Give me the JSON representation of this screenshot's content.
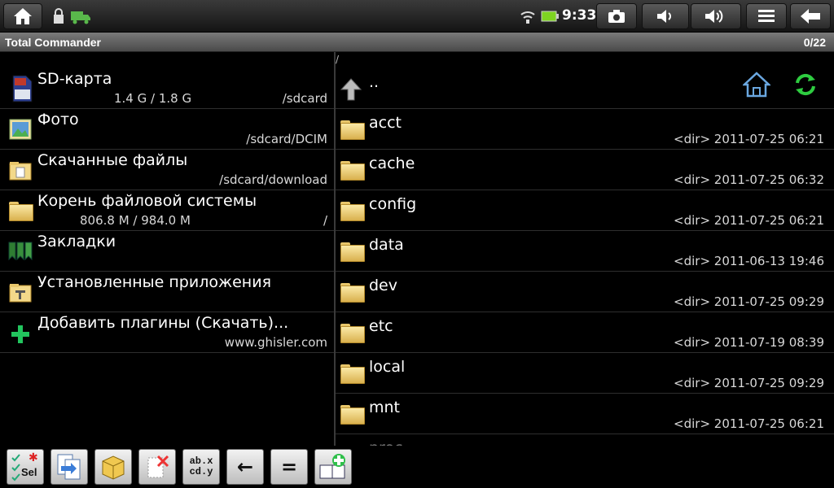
{
  "statusbar": {
    "time": "9:33",
    "icons": [
      "home-icon",
      "lock-icon",
      "truck-icon",
      "wifi-icon",
      "battery-icon",
      "camera-icon",
      "volume-down-icon",
      "volume-up-icon",
      "menu-icon",
      "back-arrow-icon"
    ]
  },
  "titlebar": {
    "title": "Total Commander",
    "count": "0/22"
  },
  "left_panel": {
    "items": [
      {
        "name": "SD-карта",
        "sub": "1.4 G / 1.8 G",
        "sub_right": "/sdcard",
        "icon": "sd-card-icon"
      },
      {
        "name": "Фото",
        "sub": "",
        "sub_right": "/sdcard/DCIM",
        "icon": "photo-icon"
      },
      {
        "name": "Скачанные файлы",
        "sub": "",
        "sub_right": "/sdcard/download",
        "icon": "download-folder-icon"
      },
      {
        "name": "Корень файловой системы",
        "sub": "806.8 M / 984.0 M",
        "sub_right": "/",
        "icon": "folder-icon"
      },
      {
        "name": "Закладки",
        "sub": "",
        "sub_right": "",
        "icon": "bookmarks-icon"
      },
      {
        "name": "Установленные приложения",
        "sub": "",
        "sub_right": "",
        "icon": "apps-folder-icon"
      },
      {
        "name": "Добавить плагины (Скачать)...",
        "sub": "",
        "sub_right": "www.ghisler.com",
        "icon": "plus-icon"
      }
    ]
  },
  "right_panel": {
    "path": "/",
    "parent": "..",
    "items": [
      {
        "name": "acct",
        "type": "<dir>",
        "date": "2011-07-25",
        "time": "06:21"
      },
      {
        "name": "cache",
        "type": "<dir>",
        "date": "2011-07-25",
        "time": "06:32"
      },
      {
        "name": "config",
        "type": "<dir>",
        "date": "2011-07-25",
        "time": "06:21"
      },
      {
        "name": "data",
        "type": "<dir>",
        "date": "2011-06-13",
        "time": "19:46"
      },
      {
        "name": "dev",
        "type": "<dir>",
        "date": "2011-07-25",
        "time": "09:29"
      },
      {
        "name": "etc",
        "type": "<dir>",
        "date": "2011-07-19",
        "time": "08:39"
      },
      {
        "name": "local",
        "type": "<dir>",
        "date": "2011-07-25",
        "time": "09:29"
      },
      {
        "name": "mnt",
        "type": "<dir>",
        "date": "2011-07-25",
        "time": "06:21"
      },
      {
        "name": "proc",
        "type": "",
        "date": "",
        "time": ""
      }
    ]
  },
  "toolbar": {
    "select_label": "Sel",
    "rename_label": "ab.x\ncd.y",
    "back_label": "←",
    "equal_label": "="
  }
}
